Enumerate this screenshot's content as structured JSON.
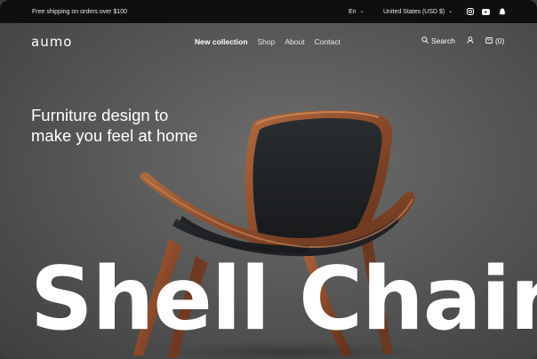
{
  "topbar": {
    "promo": "Free shipping on orders over $100",
    "language": "En",
    "currency": "United States (USD $)",
    "social_icons": [
      "instagram-icon",
      "youtube-icon",
      "snapchat-icon"
    ]
  },
  "nav": {
    "logo": "aumo",
    "menu": [
      "New collection",
      "Shop",
      "About",
      "Contact"
    ],
    "active_item": "New collection",
    "search_label": "Search",
    "cart_count": "(0)"
  },
  "hero": {
    "headline_line1": "Furniture design to",
    "headline_line2": "make you feel at home",
    "product_title": "Shell Chair"
  },
  "colors": {
    "topbar_bg": "#0f0f0f",
    "hero_bg": "#5b5b5b",
    "text": "#ffffff",
    "wood": "#8a4a2a",
    "seat": "#1e2022"
  }
}
